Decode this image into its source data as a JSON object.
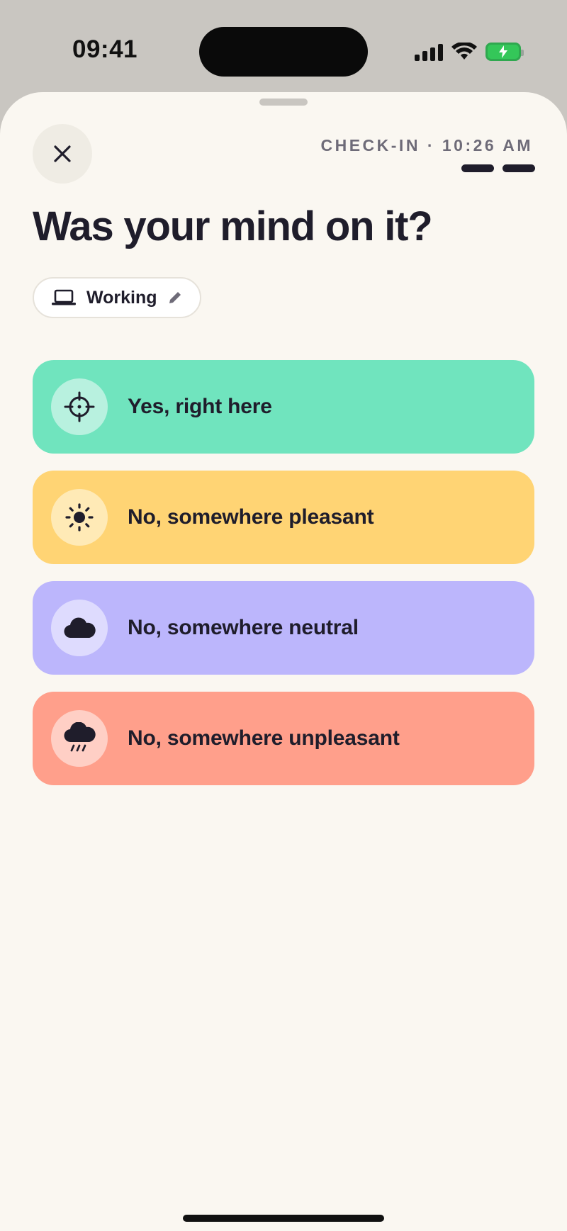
{
  "status_bar": {
    "time": "09:41"
  },
  "header": {
    "checkin_label": "CHECK-IN · 10:26 AM",
    "progress_segments": 2
  },
  "question": {
    "title": "Was your mind on it?"
  },
  "activity_chip": {
    "label": "Working",
    "icon": "laptop-icon",
    "edit_icon": "pencil-icon"
  },
  "options": [
    {
      "label": "Yes, right here",
      "icon": "crosshair-icon",
      "color": "#70e4be",
      "icon_bg": "#b8f1df"
    },
    {
      "label": "No, somewhere pleasant",
      "icon": "sun-icon",
      "color": "#ffd474",
      "icon_bg": "#ffeab6"
    },
    {
      "label": "No, somewhere neutral",
      "icon": "cloud-icon",
      "color": "#bcb6fc",
      "icon_bg": "#dedbfe"
    },
    {
      "label": "No, somewhere unpleasant",
      "icon": "rain-cloud-icon",
      "color": "#ff9f8b",
      "icon_bg": "#ffcfc5"
    }
  ],
  "colors": {
    "sheet_bg": "#faf7f1",
    "text": "#1f1d2b",
    "muted": "#6e6b78"
  }
}
